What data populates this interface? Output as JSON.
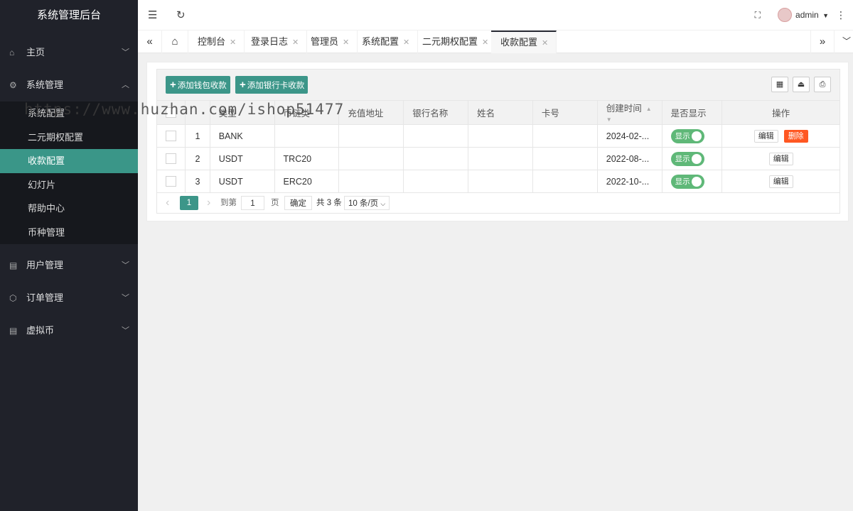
{
  "app": {
    "title": "系统管理后台"
  },
  "sidebar": {
    "items": [
      {
        "label": "主页",
        "icon": "home-icon",
        "chevron": "⌄"
      },
      {
        "label": "系统管理",
        "icon": "gear-icon",
        "chevron": "⌃"
      },
      {
        "label": "用户管理",
        "icon": "users-icon",
        "chevron": "⌄"
      },
      {
        "label": "订单管理",
        "icon": "cube-icon",
        "chevron": "⌄"
      },
      {
        "label": "虚拟币",
        "icon": "coin-icon",
        "chevron": "⌄"
      }
    ],
    "subitems": [
      "系统配置",
      "二元期权配置",
      "收款配置",
      "幻灯片",
      "帮助中心",
      "币种管理"
    ],
    "active_subitem": "收款配置"
  },
  "header": {
    "user": "admin"
  },
  "tabs": {
    "items": [
      {
        "label": "控制台"
      },
      {
        "label": "登录日志"
      },
      {
        "label": "管理员"
      },
      {
        "label": "系统配置"
      },
      {
        "label": "二元期权配置"
      },
      {
        "label": "收款配置"
      }
    ],
    "active": "收款配置"
  },
  "toolbar": {
    "add_wallet": "添加钱包收款",
    "add_bank": "添加银行卡收款"
  },
  "table": {
    "headers": [
      "类型",
      "币链类",
      "充值地址",
      "银行名称",
      "姓名",
      "卡号",
      "创建时间",
      "是否显示",
      "操作"
    ],
    "rows": [
      {
        "id": "1",
        "type": "BANK",
        "chain": "",
        "address": "",
        "bank": "",
        "name": "",
        "card": "",
        "created": "2024-02-...",
        "show": "显示",
        "edit": "编辑",
        "delete": "删除"
      },
      {
        "id": "2",
        "type": "USDT",
        "chain": "TRC20",
        "address": "",
        "bank": "",
        "name": "",
        "card": "",
        "created": "2022-08-...",
        "show": "显示",
        "edit": "编辑"
      },
      {
        "id": "3",
        "type": "USDT",
        "chain": "ERC20",
        "address": "",
        "bank": "",
        "name": "",
        "card": "",
        "created": "2022-10-...",
        "show": "显示",
        "edit": "编辑"
      }
    ]
  },
  "pager": {
    "prev": "‹",
    "current": "1",
    "next": "›",
    "goto_label": "到第",
    "goto_value": "1",
    "page_unit": "页",
    "confirm": "确定",
    "total": "共 3 条",
    "page_size": "10 条/页"
  },
  "watermark": "https://www.huzhan.com/ishop51477",
  "colors": {
    "sidebar_bg": "#20222a",
    "accent": "#3c9689",
    "switch_on": "#5fb878",
    "danger": "#ff5722"
  }
}
